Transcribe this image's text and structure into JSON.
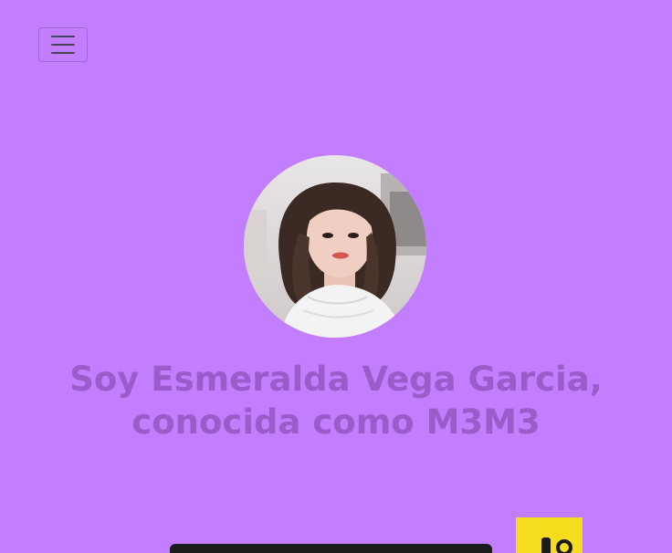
{
  "navbar": {
    "toggle_icon": "hamburger-icon"
  },
  "hero": {
    "avatar_icon": "profile-photo",
    "title_line1": "Soy Esmeralda Vega Garcia,",
    "title_line2": "conocida como M3M3"
  },
  "colors": {
    "background": "#c27eff",
    "title": "#9a5cc8"
  }
}
